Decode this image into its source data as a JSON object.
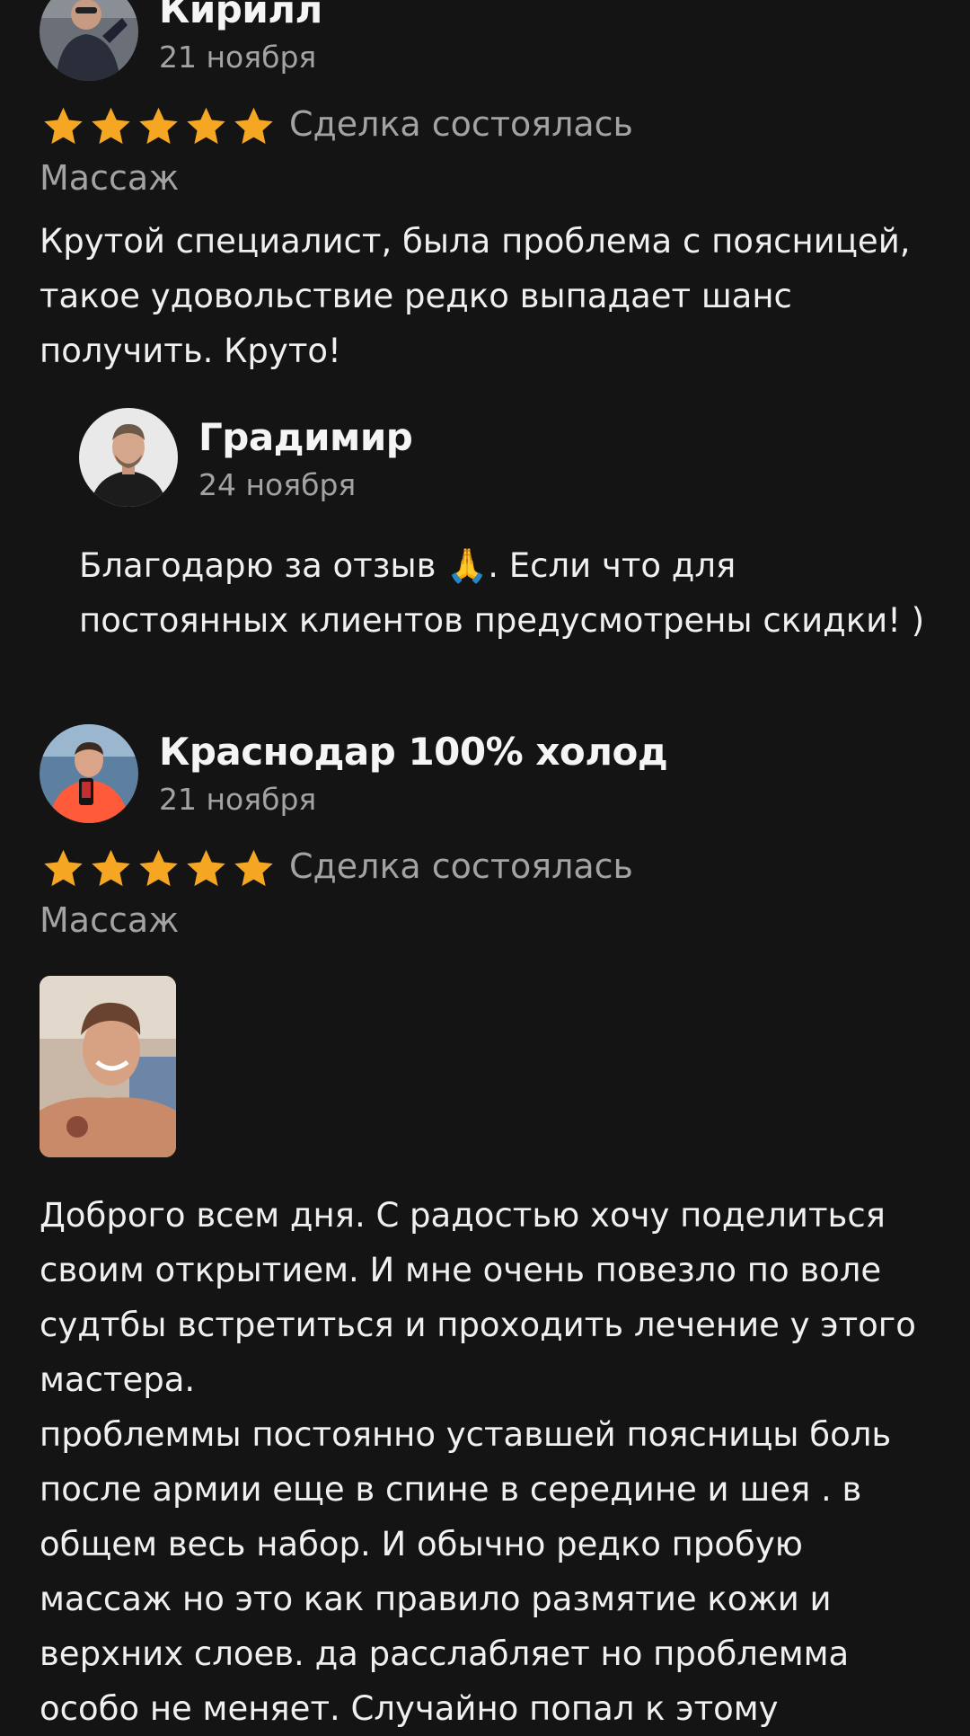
{
  "colors": {
    "background": "#141414",
    "star": "#f5a623",
    "muted_text": "#a3a3a3",
    "text": "#f0f0f0"
  },
  "reviews": [
    {
      "author": "Кирилл",
      "date": "21 ноября",
      "rating": 5,
      "status": "Сделка состоялась",
      "category": "Массаж",
      "text_lines": [
        "Крутой специалист, была проблема с поясницей,",
        "такое удовольствие редко выпадает шанс",
        "получить. Круто!"
      ],
      "reply": {
        "author": "Градимир",
        "date": "24 ноября",
        "text_lines": [
          "Благодарю за отзыв 🙏. Если что для",
          "постоянных клиентов предусмотрены скидки! )"
        ]
      }
    },
    {
      "author": "Краснодар 100% холод",
      "date": "21 ноября",
      "rating": 5,
      "status": "Сделка состоялась",
      "category": "Массаж",
      "text_lines": [
        "Доброго всем дня. С радостью хочу поделиться",
        "своим открытием. И мне очень повезло по воле",
        "судтбы встретиться и проходить лечение у этого",
        "мастера.",
        "проблеммы постоянно уставшей поясницы боль",
        "после армии еще в спине в середине и шея . в",
        "общем весь набор. И обычно редко пробую",
        "массаж но это как правило размятие кожи и",
        "верхних слоев. да расслабляет но проблемма",
        "особо не меняет. Случайно попал к этому"
      ]
    }
  ]
}
